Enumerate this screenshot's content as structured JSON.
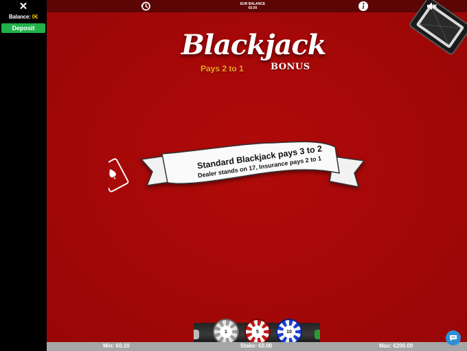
{
  "sidebar": {
    "close_icon": "close-icon",
    "balance_label": "Balance:",
    "balance_value": "0€",
    "deposit_label": "Deposit"
  },
  "topbar": {
    "history_icon": "history-icon",
    "balance_title": "EUR BALANCE",
    "balance_value": "€0.00",
    "info_icon": "info-icon",
    "mute_icon": "speaker-mute-icon"
  },
  "logo": {
    "title": "Blackjack",
    "pays": "Pays 2 to 1",
    "bonus": "BONUS"
  },
  "banner": {
    "line1": "Standard Blackjack pays 3 to 2",
    "line2": "Dealer stands on 17, Insurance pays 2 to 1"
  },
  "chips": [
    {
      "value": "1",
      "color": "#9a9a9a"
    },
    {
      "value": "5",
      "color": "#c11818"
    },
    {
      "value": "10",
      "color": "#1a3fd0"
    }
  ],
  "status": {
    "min": "Min: €0.10",
    "stake": "Stake: €0.00",
    "max": "Max: €200.00"
  },
  "colors": {
    "table": "#a60808",
    "deposit": "#21b14a",
    "balance_amount": "#f2c200",
    "pays_text": "#f6a623",
    "chat_button": "#2f8fd6"
  }
}
